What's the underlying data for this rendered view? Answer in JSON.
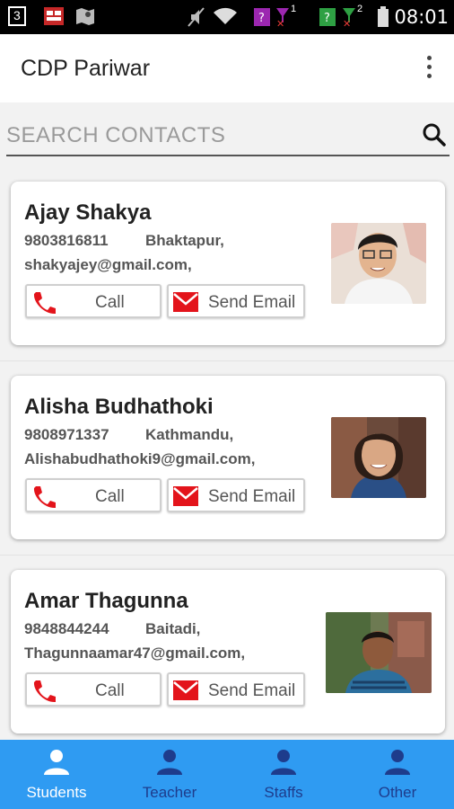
{
  "status_bar": {
    "time": "08:01",
    "sim1_label": "1",
    "sim2_label": "2",
    "notif_num": "3",
    "colors": {
      "sim1": "#9c27b0",
      "sim2": "#2ea043",
      "signal_x": "#e53935"
    }
  },
  "app_bar": {
    "title": "CDP Pariwar",
    "menu_icon": "more-vert-icon"
  },
  "search": {
    "placeholder": "SEARCH CONTACTS",
    "value": "",
    "icon": "search-icon"
  },
  "contacts": [
    {
      "name": "Ajay Shakya",
      "phone": "9803816811",
      "city": "Bhaktapur,",
      "email": "shakyajey@gmail.com,",
      "call_label": "Call",
      "email_label": "Send Email"
    },
    {
      "name": "Alisha Budhathoki",
      "phone": "9808971337",
      "city": "Kathmandu,",
      "email": "Alishabudhathoki9@gmail.com,",
      "call_label": "Call",
      "email_label": "Send Email"
    },
    {
      "name": "Amar Thagunna",
      "phone": "9848844244",
      "city": "Baitadi,",
      "email": "Thagunnaamar47@gmail.com,",
      "call_label": "Call",
      "email_label": "Send Email"
    }
  ],
  "bottom_nav": {
    "items": [
      {
        "label": "Students",
        "icon": "person-icon",
        "active": true
      },
      {
        "label": "Teacher",
        "icon": "person-icon",
        "active": false
      },
      {
        "label": "Staffs",
        "icon": "person-icon",
        "active": false
      },
      {
        "label": "Other",
        "icon": "person-icon",
        "active": false
      }
    ],
    "colors": {
      "background": "#2f9bf2",
      "active": "#ffffff",
      "inactive": "#1e3c8c"
    }
  },
  "accent_colors": {
    "call_icon": "#e3141b",
    "mail_icon": "#e3141b"
  }
}
